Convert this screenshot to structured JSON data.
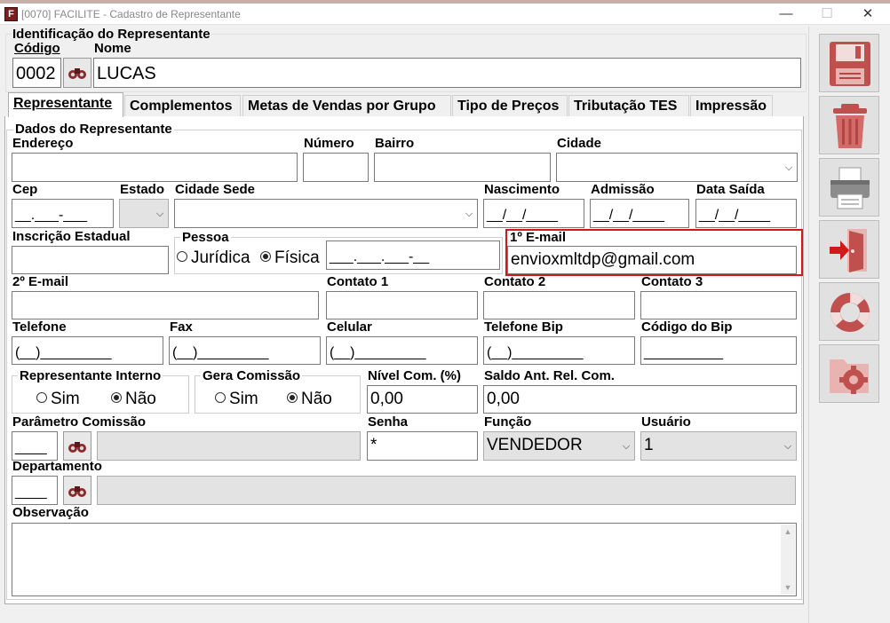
{
  "window": {
    "title": "[0070] FACILITE - Cadastro de Representante",
    "icon_name": "facilite-app-icon",
    "controls": {
      "minimize": "—",
      "maximize": "☐",
      "close": "✕"
    }
  },
  "header": {
    "group_title": "Identificação do Representante",
    "codigo_label": "Código",
    "codigo_value": "0002",
    "nome_label": "Nome",
    "nome_value": "LUCAS"
  },
  "tabs": [
    {
      "label": "Representante",
      "active": true
    },
    {
      "label": "Complementos"
    },
    {
      "label": "Metas de Vendas por Grupo"
    },
    {
      "label": "Tipo de Preços"
    },
    {
      "label": "Tributação TES"
    },
    {
      "label": "Impressão"
    }
  ],
  "form": {
    "group_title": "Dados do Representante",
    "endereco_label": "Endereço",
    "endereco_value": "",
    "numero_label": "Número",
    "numero_value": "",
    "bairro_label": "Bairro",
    "bairro_value": "",
    "cidade_label": "Cidade",
    "cidade_value": "",
    "cep_label": "Cep",
    "cep_value": "__.___-___",
    "estado_label": "Estado",
    "estado_value": "",
    "cidade_sede_label": "Cidade Sede",
    "cidade_sede_value": "",
    "nascimento_label": "Nascimento",
    "nascimento_value": "__/__/____",
    "admissao_label": "Admissão",
    "admissao_value": "__/__/____",
    "data_saida_label": "Data Saída",
    "data_saida_value": "__/__/____",
    "inscricao_label": "Inscrição Estadual",
    "inscricao_value": "",
    "pessoa_label": "Pessoa",
    "pessoa_juridica": "Jurídica",
    "pessoa_fisica": "Física",
    "pessoa_selected": "Física",
    "cpf_value": "___.___.___-__",
    "email1_label": "1º E-mail",
    "email1_value": "envioxmltdp@gmail.com",
    "email2_label": "2º E-mail",
    "email2_value": "",
    "contato1_label": "Contato 1",
    "contato1_value": "",
    "contato2_label": "Contato 2",
    "contato2_value": "",
    "contato3_label": "Contato 3",
    "contato3_value": "",
    "telefone_label": "Telefone",
    "telefone_value": "(__)_________",
    "fax_label": "Fax",
    "fax_value": "(__)_________",
    "celular_label": "Celular",
    "celular_value": "(__)_________",
    "telefone_bip_label": "Telefone Bip",
    "telefone_bip_value": "(__)_________",
    "codigo_bip_label": "Código do Bip",
    "codigo_bip_value": "__________",
    "rep_interno_label": "Representante Interno",
    "rep_interno_sim": "Sim",
    "rep_interno_nao": "Não",
    "rep_interno_selected": "Não",
    "gera_comissao_label": "Gera Comissão",
    "gera_comissao_sim": "Sim",
    "gera_comissao_nao": "Não",
    "gera_comissao_selected": "Não",
    "nivel_com_label": "Nível Com. (%)",
    "nivel_com_value": "0,00",
    "saldo_ant_label": "Saldo Ant. Rel. Com.",
    "saldo_ant_value": "0,00",
    "parametro_comissao_label": "Parâmetro Comissão",
    "parametro_comissao_code": "____",
    "parametro_comissao_desc": "",
    "senha_label": "Senha",
    "senha_value": "*",
    "funcao_label": "Função",
    "funcao_value": "VENDEDOR",
    "usuario_label": "Usuário",
    "usuario_value": "1",
    "departamento_label": "Departamento",
    "departamento_code": "____",
    "departamento_desc": "",
    "observacao_label": "Observação",
    "observacao_value": ""
  },
  "toolbar": {
    "buttons": [
      {
        "name": "save",
        "icon": "floppy-disk-icon"
      },
      {
        "name": "delete",
        "icon": "trash-can-icon"
      },
      {
        "name": "print",
        "icon": "printer-icon"
      },
      {
        "name": "exit",
        "icon": "exit-door-icon"
      },
      {
        "name": "help",
        "icon": "lifebuoy-icon"
      },
      {
        "name": "settings",
        "icon": "folder-gear-icon"
      }
    ]
  },
  "colors": {
    "accent_red": "#c0504d",
    "highlight_border": "#d0191b",
    "window_bg": "#f0f0f0",
    "disabled_field": "#e3e3e3"
  }
}
